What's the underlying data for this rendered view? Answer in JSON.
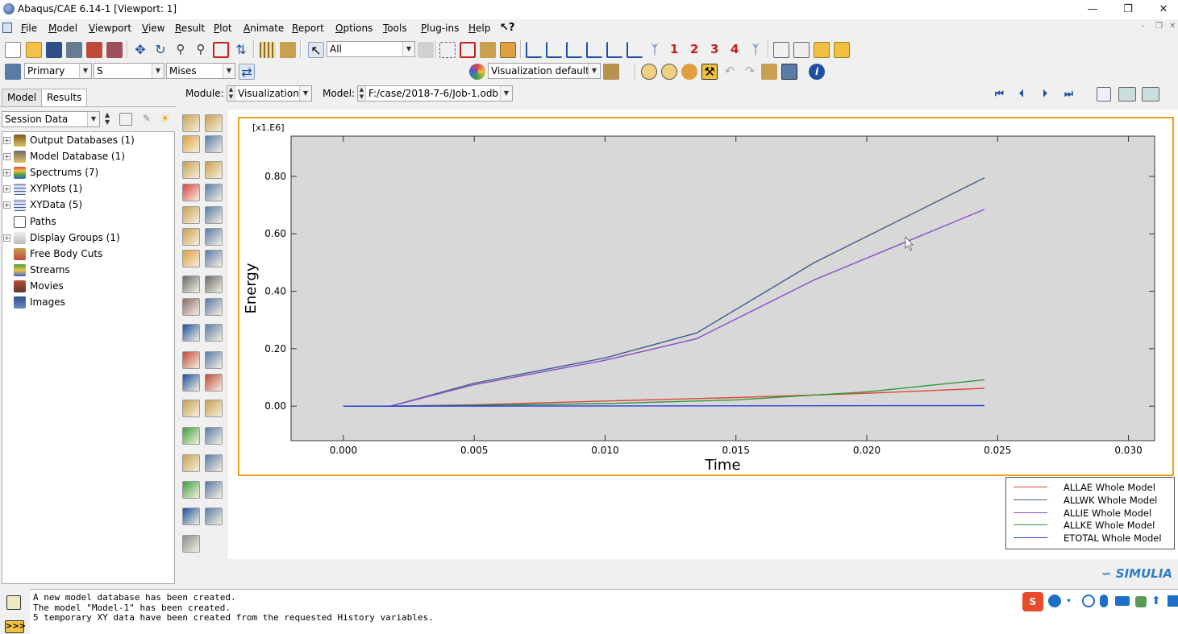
{
  "window": {
    "title": "Abaqus/CAE 6.14-1 [Viewport: 1]"
  },
  "menu": [
    "File",
    "Model",
    "Viewport",
    "View",
    "Result",
    "Plot",
    "Animate",
    "Report",
    "Options",
    "Tools",
    "Plug-ins",
    "Help"
  ],
  "toolbar": {
    "selection_filter": "All",
    "field_output": {
      "primary": "Primary",
      "variable": "S",
      "invariant": "Mises"
    },
    "visualization_defaults": "Visualization defaults",
    "view_numbers": [
      "1",
      "2",
      "3",
      "4"
    ]
  },
  "context": {
    "module_label": "Module:",
    "module_value": "Visualization",
    "model_label": "Model:",
    "model_value": "F:/case/2018-7-6/Job-1.odb"
  },
  "tabs": [
    {
      "label": "Model"
    },
    {
      "label": "Results"
    }
  ],
  "session_combo": "Session Data",
  "tree": [
    {
      "label": "Output Databases (1)",
      "expandable": true,
      "icon": "database-icon"
    },
    {
      "label": "Model Database (1)",
      "expandable": true,
      "icon": "model-db-icon"
    },
    {
      "label": "Spectrums (7)",
      "expandable": true,
      "icon": "spectrum-icon"
    },
    {
      "label": "XYPlots (1)",
      "expandable": true,
      "icon": "grid-icon"
    },
    {
      "label": "XYData (5)",
      "expandable": true,
      "icon": "grid-icon"
    },
    {
      "label": "Paths",
      "expandable": false,
      "icon": "path-icon"
    },
    {
      "label": "Display Groups (1)",
      "expandable": true,
      "icon": "display-group-icon"
    },
    {
      "label": "Free Body Cuts",
      "expandable": false,
      "icon": "free-body-icon"
    },
    {
      "label": "Streams",
      "expandable": false,
      "icon": "stream-icon"
    },
    {
      "label": "Movies",
      "expandable": false,
      "icon": "movie-icon"
    },
    {
      "label": "Images",
      "expandable": false,
      "icon": "image-icon"
    }
  ],
  "chart_data": {
    "type": "line",
    "xlabel": "Time",
    "ylabel": "Energy",
    "y_scale_label": "[x1.E6]",
    "xlim": [
      -0.002,
      0.031
    ],
    "ylim": [
      -0.12,
      0.94
    ],
    "x_ticks": [
      "0.000",
      "0.005",
      "0.010",
      "0.015",
      "0.020",
      "0.025",
      "0.030"
    ],
    "x_tick_values": [
      0,
      0.005,
      0.01,
      0.015,
      0.02,
      0.025,
      0.03
    ],
    "y_ticks": [
      "0.00",
      "0.20",
      "0.40",
      "0.60",
      "0.80"
    ],
    "y_tick_values": [
      0,
      0.2,
      0.4,
      0.6,
      0.8
    ],
    "grid": false,
    "legend_position": "bottom-right-outside",
    "series": [
      {
        "name": "ALLAE Whole Model",
        "color": "#e0453a",
        "points": [
          [
            0,
            0
          ],
          [
            0.002,
            0
          ],
          [
            0.005,
            0.005
          ],
          [
            0.01,
            0.018
          ],
          [
            0.015,
            0.03
          ],
          [
            0.02,
            0.045
          ],
          [
            0.0245,
            0.062
          ]
        ]
      },
      {
        "name": "ALLWK Whole Model",
        "color": "#3f5f8a",
        "points": [
          [
            0,
            0
          ],
          [
            0.0018,
            0
          ],
          [
            0.005,
            0.08
          ],
          [
            0.01,
            0.168
          ],
          [
            0.0135,
            0.255
          ],
          [
            0.018,
            0.5
          ],
          [
            0.0245,
            0.795
          ]
        ]
      },
      {
        "name": "ALLIE Whole Model",
        "color": "#8a4fc8",
        "points": [
          [
            0,
            0
          ],
          [
            0.0018,
            0
          ],
          [
            0.005,
            0.075
          ],
          [
            0.01,
            0.16
          ],
          [
            0.0135,
            0.235
          ],
          [
            0.018,
            0.44
          ],
          [
            0.0245,
            0.685
          ]
        ]
      },
      {
        "name": "ALLKE Whole Model",
        "color": "#2e9a3a",
        "points": [
          [
            0,
            0
          ],
          [
            0.0018,
            0
          ],
          [
            0.005,
            0.003
          ],
          [
            0.01,
            0.009
          ],
          [
            0.015,
            0.022
          ],
          [
            0.02,
            0.05
          ],
          [
            0.0245,
            0.092
          ]
        ]
      },
      {
        "name": "ETOTAL Whole Model",
        "color": "#2a3ee0",
        "points": [
          [
            0,
            0
          ],
          [
            0.01,
            0.001
          ],
          [
            0.0245,
            0.002
          ]
        ]
      }
    ]
  },
  "messages": [
    "A new model database has been created.",
    "The model \"Model-1\" has been created.",
    "5 temporary XY data have been created from the requested History variables."
  ],
  "brand": "SIMULIA",
  "colors": {
    "viewport_border": "#f0a020",
    "plot_bg": "#d8d8d8"
  }
}
